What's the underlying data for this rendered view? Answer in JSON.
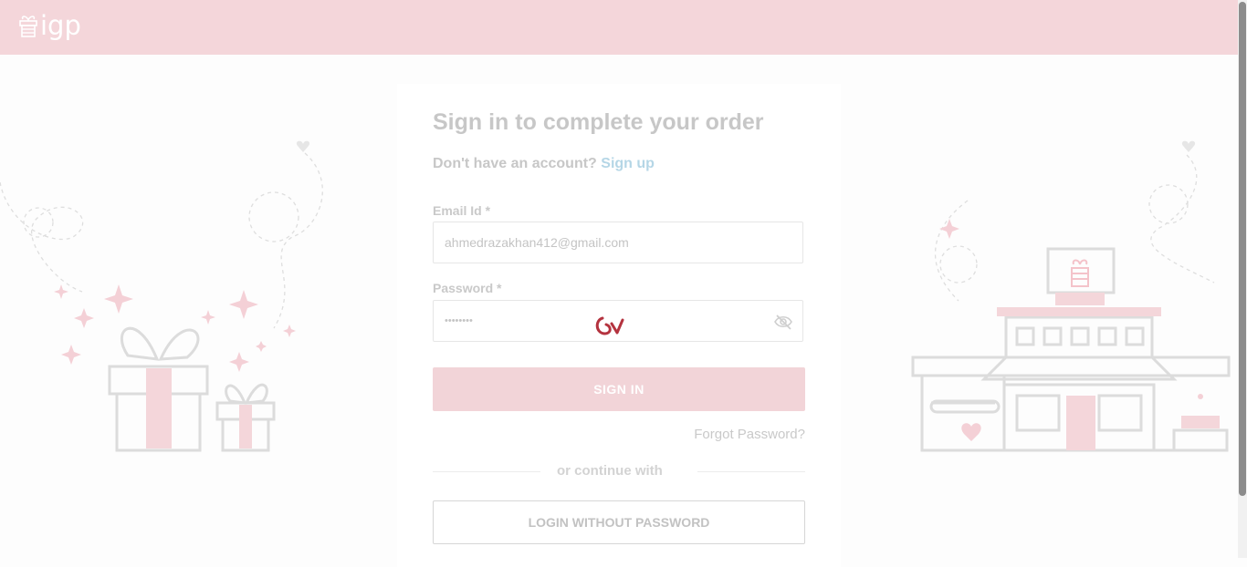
{
  "brand": {
    "logo_text": "igp"
  },
  "login": {
    "title": "Sign in to complete your order",
    "no_account_text": "Don't have an account?",
    "signup_link": "Sign up",
    "email_label": "Email Id *",
    "email_value": "ahmedrazakhan412@gmail.com",
    "password_label": "Password *",
    "password_value": "••••••••",
    "signin_button": "SIGN IN",
    "forgot_password": "Forgot Password?",
    "divider_text": "or continue with",
    "login_without_password": "LOGIN WITHOUT PASSWORD"
  },
  "icons": {
    "logo": "gift-logo-icon",
    "password_toggle": "eye-slash-icon",
    "loading": "spinner-icon"
  },
  "colors": {
    "header_bg": "#f4d6da",
    "accent_pink": "#f2d4d8",
    "link": "#b5d6e6"
  }
}
